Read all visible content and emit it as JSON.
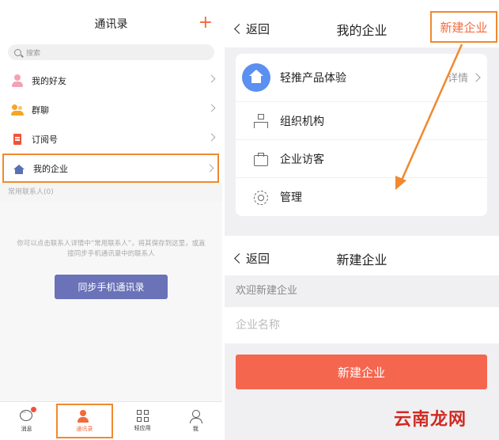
{
  "left": {
    "title": "通讯录",
    "plus": "+",
    "search_placeholder": "搜索",
    "items": [
      {
        "label": "我的好友"
      },
      {
        "label": "群聊"
      },
      {
        "label": "订阅号"
      },
      {
        "label": "我的企业"
      }
    ],
    "section": "常用联系人(0)",
    "hint": "你可以点击联系人详情中“常用联系人”，将其保存到这里，或直接同步手机通讯录中的联系人",
    "sync_button": "同步手机通讯录",
    "tabs": [
      {
        "label": "消息"
      },
      {
        "label": "通讯录"
      },
      {
        "label": "轻应用"
      },
      {
        "label": "我"
      }
    ]
  },
  "right": {
    "back": "返回",
    "title": "我的企业",
    "new_enterprise": "新建企业",
    "enterprise_name": "轻推产品体验",
    "detail": "详情",
    "menu": [
      {
        "label": "组织机构"
      },
      {
        "label": "企业访客"
      },
      {
        "label": "管理"
      }
    ]
  },
  "create": {
    "back": "返回",
    "title": "新建企业",
    "welcome": "欢迎新建企业",
    "name_placeholder": "企业名称",
    "button": "新建企业"
  },
  "watermark": "云南龙网",
  "colors": {
    "accent": "#f26a3c",
    "highlight_border": "#f0892f",
    "sync_button": "#6a72b8",
    "create_button": "#f5664f"
  }
}
